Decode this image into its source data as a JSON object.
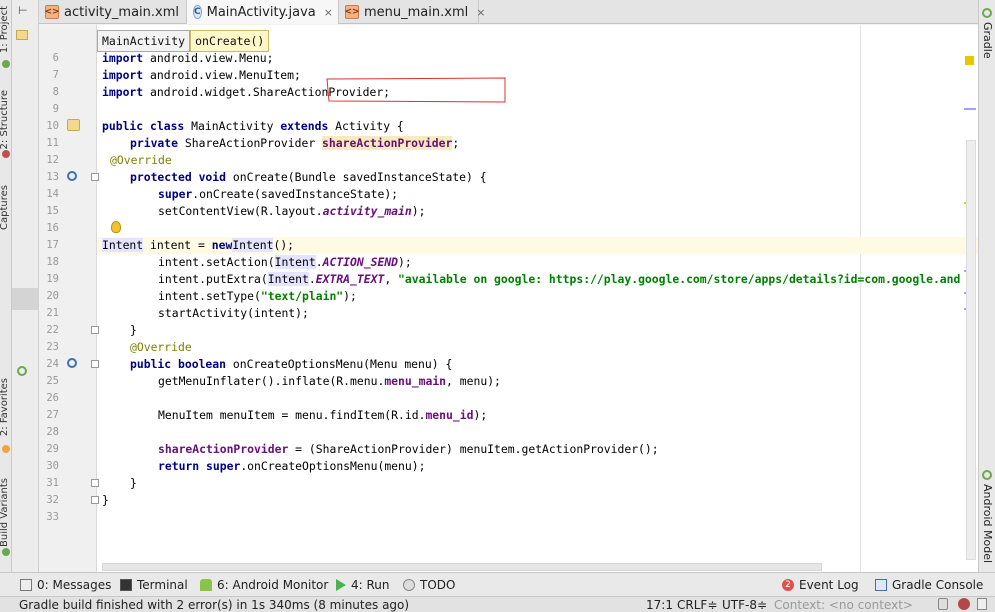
{
  "tabs": [
    {
      "label": "activity_main.xml",
      "icon": "xml-file-icon",
      "active": false
    },
    {
      "label": "MainActivity.java",
      "icon": "java-class-icon",
      "active": true
    },
    {
      "label": "menu_main.xml",
      "icon": "xml-file-icon",
      "active": false
    }
  ],
  "close_glyph": "×",
  "breadcrumb": [
    "MainActivity",
    "onCreate()"
  ],
  "left_tools": [
    "1: Project",
    "2: Structure",
    "Captures",
    "2: Favorites",
    "Build Variants"
  ],
  "right_tools": [
    "Gradle",
    "Android Model"
  ],
  "line_numbers": [
    "6",
    "7",
    "8",
    "9",
    "10",
    "11",
    "12",
    "13",
    "14",
    "15",
    "16",
    "17",
    "18",
    "19",
    "20",
    "21",
    "22",
    "23",
    "24",
    "25",
    "26",
    "27",
    "28",
    "29",
    "30",
    "31",
    "32",
    "33"
  ],
  "code": {
    "l6": "import android.view.Menu;",
    "l7": "import android.view.MenuItem;",
    "l8": "import android.widget.ShareActionProvider;",
    "l10_kw1": "public class",
    "l10_name": " MainActivity ",
    "l10_kw2": "extends",
    "l10_rest": " Activity {",
    "l11_kw": "private",
    "l11_type": " ShareActionProvider ",
    "l11_field": "shareActionProvider",
    "l11_end": ";",
    "l12": "@Override",
    "l13_kw": "protected void",
    "l13_rest": " onCreate(Bundle savedInstanceState) {",
    "l14_kw": "super",
    "l14_rest": ".onCreate(savedInstanceState);",
    "l15_a": "setContentView(R.layout.",
    "l15_b": "activity_main",
    "l15_c": ");",
    "l17_a": "Intent",
    "l17_b": " intent = ",
    "l17_kw": "new",
    "l17_c": "Intent",
    "l17_d": "();",
    "l18_a": "intent.setAction(",
    "l18_b": "Intent",
    "l18_c": ".",
    "l18_d": "ACTION_SEND",
    "l18_e": ");",
    "l19_a": "intent.putExtra(",
    "l19_b": "Intent",
    "l19_c": ".",
    "l19_d": "EXTRA_TEXT",
    "l19_e": ", ",
    "l19_str": "\"available on google: https://play.google.com/store/apps/details?id=com.google.and",
    "l20_a": "intent.setType(",
    "l20_str": "\"text/plain\"",
    "l20_b": ");",
    "l21": "startActivity(intent);",
    "l22": "}",
    "l23": "@Override",
    "l24_kw": "public boolean",
    "l24_rest": " onCreateOptionsMenu(Menu menu) {",
    "l25_a": "getMenuInflater().inflate(R.menu.",
    "l25_b": "menu_main",
    "l25_c": ", menu);",
    "l27_a": "MenuItem menuItem = menu.findItem(R.id.",
    "l27_b": "menu_id",
    "l27_c": ");",
    "l29_field": "shareActionProvider",
    "l29_rest": " = (ShareActionProvider) menuItem.getActionProvider();",
    "l30_kw1": "return",
    "l30_kw2": "super",
    "l30_rest": ".onCreateOptionsMenu(menu);",
    "l31": "}",
    "l32": "}"
  },
  "bottom_tools": [
    {
      "label": "0: Messages",
      "icon": "messages-icon"
    },
    {
      "label": "Terminal",
      "icon": "terminal-icon"
    },
    {
      "label": "6: Android Monitor",
      "icon": "android-icon"
    },
    {
      "label": "4: Run",
      "icon": "run-icon"
    },
    {
      "label": "TODO",
      "icon": "todo-icon"
    },
    {
      "label": "Event Log",
      "icon": "event-log-icon",
      "badge": "2"
    },
    {
      "label": "Gradle Console",
      "icon": "gradle-console-icon"
    }
  ],
  "status": {
    "message": "Gradle build finished with 2 error(s) in 1s 340ms (8 minutes ago)",
    "position": "17:1",
    "line_sep": "CRLF",
    "encoding": "UTF-8",
    "context": "Context: <no context>",
    "sep_glyph": "≑"
  },
  "colors": {
    "keyword": "#000080",
    "string": "#008000",
    "annotation": "#808000",
    "field": "#660e7a",
    "error_badge": "#d9534f"
  }
}
